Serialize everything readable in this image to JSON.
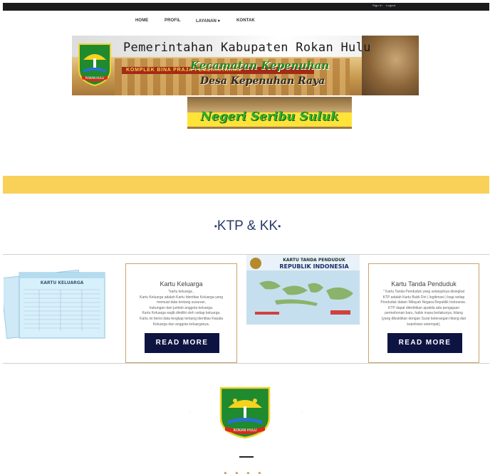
{
  "topbar": {
    "links": [
      "Sign In",
      "Logout"
    ]
  },
  "nav": {
    "items": [
      {
        "label": "HOME"
      },
      {
        "label": "PROFIL"
      },
      {
        "label": "LAYANAN",
        "caret": "▾"
      },
      {
        "label": "KONTAK"
      }
    ]
  },
  "banner": {
    "title": "Pemerintahan Kabupaten Rokan Hulu",
    "subtitle": "Kecamatan Kepenuhan",
    "village": "Desa Kepenuhan Raya",
    "building_sign": "KOMPLEK BINA PRAJA PEMERINTAHAN",
    "emblem_ribbon": "ROKAN HULU"
  },
  "slogan": {
    "text": "Negeri Seribu Suluk"
  },
  "section": {
    "title": "KTP & KK",
    "bullet": "•"
  },
  "images": {
    "kk_doc_title": "KARTU KELUARGA",
    "ktp_header_line1": "KARTU TANDA PENDUDUK",
    "ktp_header_line2": "REPUBLIK INDONESIA"
  },
  "cards": [
    {
      "title": "Kartu Keluarga",
      "body": [
        "\"kartu keluarga ,",
        "Kartu Keluarga adalah Kartu Identitas Keluarga yang",
        "memuat data tentang susunan,",
        "hubungan dan jumlah anggota keluarga.",
        "Kartu Keluarga wajib dimiliki oleh setiap keluarga.",
        "Kartu ini berisi data lengkap tentang identitas Kepala",
        "Keluarga dan anggota keluarganya."
      ],
      "button": "READ MORE"
    },
    {
      "title": "Kartu Tanda Penduduk",
      "body": [
        "\" Kartu Tanda Penduduk yang selanjutnya disingkat",
        "KTP adalah Kartu Bukti Diri ( legitimasi ) bagi setiap",
        "Penduduk dalam Wilayah Negara Republik Indonesia .",
        "KTP dapat diterbitkan apabila ada pengajuan",
        "permohonan baru, habis masa berlakunya, hilang",
        "(yang dibuktikan dengan Surat keterangan hilang dari",
        "kepolisian setempat),"
      ],
      "button": "READ MORE"
    }
  ],
  "footer": {
    "left_mark": ".",
    "right_mark": ".",
    "emblem_ribbon": "ROKAN HULU",
    "social_icons": [
      "facebook-icon",
      "twitter-icon",
      "googleplus-icon",
      "pinterest-icon"
    ]
  },
  "colors": {
    "topbar": "#1b1b1b",
    "highlight_bar": "#f9d058",
    "accent_border": "#c8a46a",
    "button_bg": "#0e1442",
    "title_text": "#2b3a67"
  }
}
